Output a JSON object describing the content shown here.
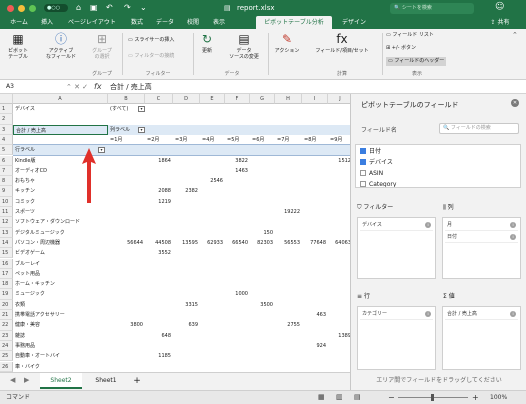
{
  "window": {
    "title": "report.xlsx",
    "autosave": "●○○",
    "search_placeholder": "シートを検索"
  },
  "tabs": [
    "ホーム",
    "挿入",
    "ページレイアウト",
    "数式",
    "データ",
    "校閲",
    "表示",
    "ピボットテーブル分析",
    "デザイン"
  ],
  "share_label": "共有",
  "ribbon": {
    "pivot_table": "ピボット\nテーブル",
    "active_field": "アクティブ\nなフィールド",
    "group": "グループ\nの選択",
    "group_label": "グループ",
    "insert_slicer": "スライサーの挿入",
    "filter_connections": "フィルターの接続",
    "filter_group_label": "フィルター",
    "refresh": "更新",
    "change_source": "データ\nソースの変更",
    "data_group_label": "データ",
    "actions": "アクション",
    "fields_items": "フィールド/項目/セット",
    "calc_group_label": "計算",
    "field_list": "フィールド リスト",
    "buttons": "+/- ボタン",
    "field_headers": "フィールドのヘッダー",
    "show_group_label": "表示"
  },
  "formula_bar": {
    "name_box": "A3",
    "fx": "fx",
    "value": "合計 / 売上高"
  },
  "columns": [
    "A",
    "B",
    "C",
    "D",
    "E",
    "F",
    "G",
    "H",
    "I",
    "J"
  ],
  "row_numbers": [
    "1",
    "2",
    "3",
    "4",
    "5",
    "6",
    "7",
    "8",
    "9",
    "10",
    "11",
    "12",
    "13",
    "14",
    "15",
    "16",
    "17",
    "18",
    "19",
    "20",
    "21",
    "22",
    "23",
    "24",
    "25",
    "26"
  ],
  "pivot": {
    "filter_label": "デバイス",
    "filter_value": "(すべて)",
    "value_label": "合計 / 売上高",
    "column_label": "列ラベル",
    "row_label": "行ラベル",
    "months": [
      "=1月",
      "=2月",
      "=3月",
      "=4月",
      "=5月",
      "=6月",
      "=7月",
      "=8月",
      "=9月"
    ],
    "rows": [
      {
        "label": "Kindle版",
        "cells": [
          "",
          "1864",
          "",
          "",
          "3822",
          "",
          "",
          "",
          "1512"
        ]
      },
      {
        "label": "オーディオCD",
        "cells": [
          "",
          "",
          "",
          "",
          "1463",
          "",
          "",
          "",
          ""
        ]
      },
      {
        "label": "おもちゃ",
        "cells": [
          "",
          "",
          "",
          "2546",
          "",
          "",
          "",
          "",
          ""
        ]
      },
      {
        "label": "キッチン",
        "cells": [
          "",
          "2088",
          "2382",
          "",
          "",
          "",
          "",
          "",
          ""
        ]
      },
      {
        "label": "コミック",
        "cells": [
          "",
          "1219",
          "",
          "",
          "",
          "",
          "",
          "",
          ""
        ]
      },
      {
        "label": "スポーツ",
        "cells": [
          "",
          "",
          "",
          "",
          "",
          "",
          "19222",
          "",
          ""
        ]
      },
      {
        "label": "ソフトウェア・ダウンロード",
        "cells": [
          "",
          "",
          "",
          "",
          "",
          "",
          "",
          "",
          ""
        ]
      },
      {
        "label": "デジタルミュージック",
        "cells": [
          "",
          "",
          "",
          "",
          "",
          "150",
          "",
          "",
          ""
        ]
      },
      {
        "label": "パソコン・周辺機器",
        "cells": [
          "56644",
          "44508",
          "13595",
          "62933",
          "66540",
          "82303",
          "56553",
          "77648",
          "64063"
        ]
      },
      {
        "label": "ビデオゲーム",
        "cells": [
          "",
          "3552",
          "",
          "",
          "",
          "",
          "",
          "",
          ""
        ]
      },
      {
        "label": "ブルーレイ",
        "cells": [
          "",
          "",
          "",
          "",
          "",
          "",
          "",
          "",
          ""
        ]
      },
      {
        "label": "ペット用品",
        "cells": [
          "",
          "",
          "",
          "",
          "",
          "",
          "",
          "",
          ""
        ]
      },
      {
        "label": "ホーム・キッチン",
        "cells": [
          "",
          "",
          "",
          "",
          "",
          "",
          "",
          "",
          ""
        ]
      },
      {
        "label": "ミュージック",
        "cells": [
          "",
          "",
          "",
          "",
          "1000",
          "",
          "",
          "",
          ""
        ]
      },
      {
        "label": "衣類",
        "cells": [
          "",
          "",
          "3315",
          "",
          "",
          "3500",
          "",
          "",
          ""
        ]
      },
      {
        "label": "携帯電話アクセサリー",
        "cells": [
          "",
          "",
          "",
          "",
          "",
          "",
          "",
          "463",
          ""
        ]
      },
      {
        "label": "健康・美容",
        "cells": [
          "3800",
          "",
          "639",
          "",
          "",
          "",
          "2755",
          "",
          ""
        ]
      },
      {
        "label": "雑誌",
        "cells": [
          "",
          "648",
          "",
          "",
          "",
          "",
          "",
          "",
          "1389"
        ]
      },
      {
        "label": "事務用品",
        "cells": [
          "",
          "",
          "",
          "",
          "",
          "",
          "",
          "924",
          ""
        ]
      },
      {
        "label": "自動車・オートバイ",
        "cells": [
          "",
          "1185",
          "",
          "",
          "",
          "",
          "",
          "",
          ""
        ]
      },
      {
        "label": "車・バイク",
        "cells": [
          "",
          "",
          "",
          "",
          "",
          "",
          "",
          "",
          ""
        ]
      }
    ]
  },
  "sheets": [
    "Sheet2",
    "Sheet1"
  ],
  "add_sheet": "+",
  "status": {
    "mode": "コマンド",
    "zoom": "100%"
  },
  "field_pane": {
    "title": "ピボットテーブルのフィールド",
    "field_name_label": "フィールド名",
    "search_placeholder": "フィールドの検索",
    "fields": [
      {
        "name": "日付",
        "checked": true
      },
      {
        "name": "デバイス",
        "checked": true
      },
      {
        "name": "ASIN",
        "checked": false
      },
      {
        "name": "Category",
        "checked": false
      }
    ],
    "filters_label": "フィルター",
    "columns_label": "列",
    "rows_label": "行",
    "values_label": "値",
    "filter_items": [
      "デバイス"
    ],
    "column_items": [
      "月",
      "日付"
    ],
    "row_items": [
      "カテゴリー"
    ],
    "value_items": [
      "合計 / 売上高"
    ],
    "drag_tip": "エリア間でフィールドをドラッグしてください"
  },
  "colors": {
    "accent": "#217346",
    "arrow": "#e0302a"
  }
}
